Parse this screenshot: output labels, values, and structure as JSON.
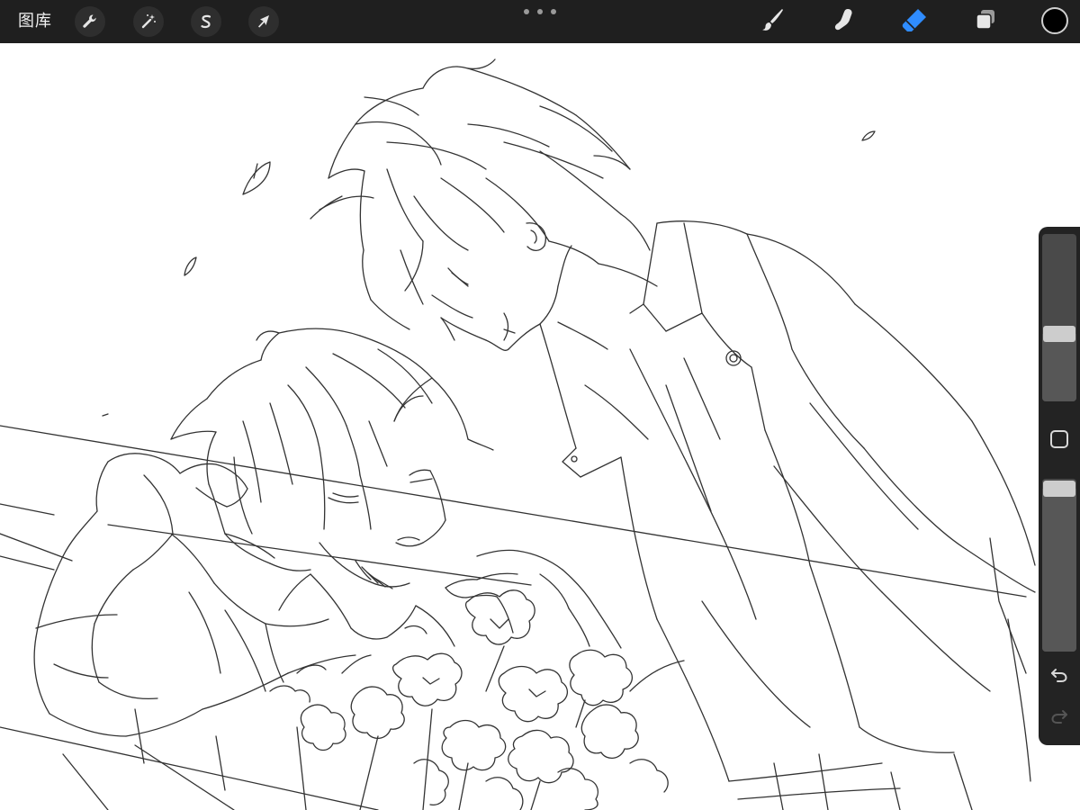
{
  "toolbar": {
    "gallery_label": "图库",
    "left_tools": [
      {
        "name": "actions",
        "icon": "wrench-icon"
      },
      {
        "name": "adjustments",
        "icon": "magic-wand-icon"
      },
      {
        "name": "selection",
        "icon": "selection-s-icon"
      },
      {
        "name": "transform",
        "icon": "arrow-cursor-icon"
      }
    ],
    "center_menu_icon": "more-dots-icon",
    "right_tools": [
      {
        "name": "brush",
        "icon": "brush-icon",
        "active": false
      },
      {
        "name": "smudge",
        "icon": "smudge-finger-icon",
        "active": false
      },
      {
        "name": "eraser",
        "icon": "eraser-icon",
        "active": true
      },
      {
        "name": "layers",
        "icon": "layers-icon",
        "active": false
      }
    ],
    "current_color": "#000000",
    "accent_color": "#2f8cff",
    "background_color": "#1f1f1f"
  },
  "sidebar": {
    "brush_size_level": 0.39,
    "brush_opacity_level": 1.0,
    "modify_button_icon": "square-modify-icon",
    "undo_icon": "undo-arrow-icon",
    "redo_icon": "redo-arrow-icon",
    "redo_enabled": false
  },
  "canvas": {
    "content": "line-art-sketch",
    "background_color": "#ffffff"
  }
}
